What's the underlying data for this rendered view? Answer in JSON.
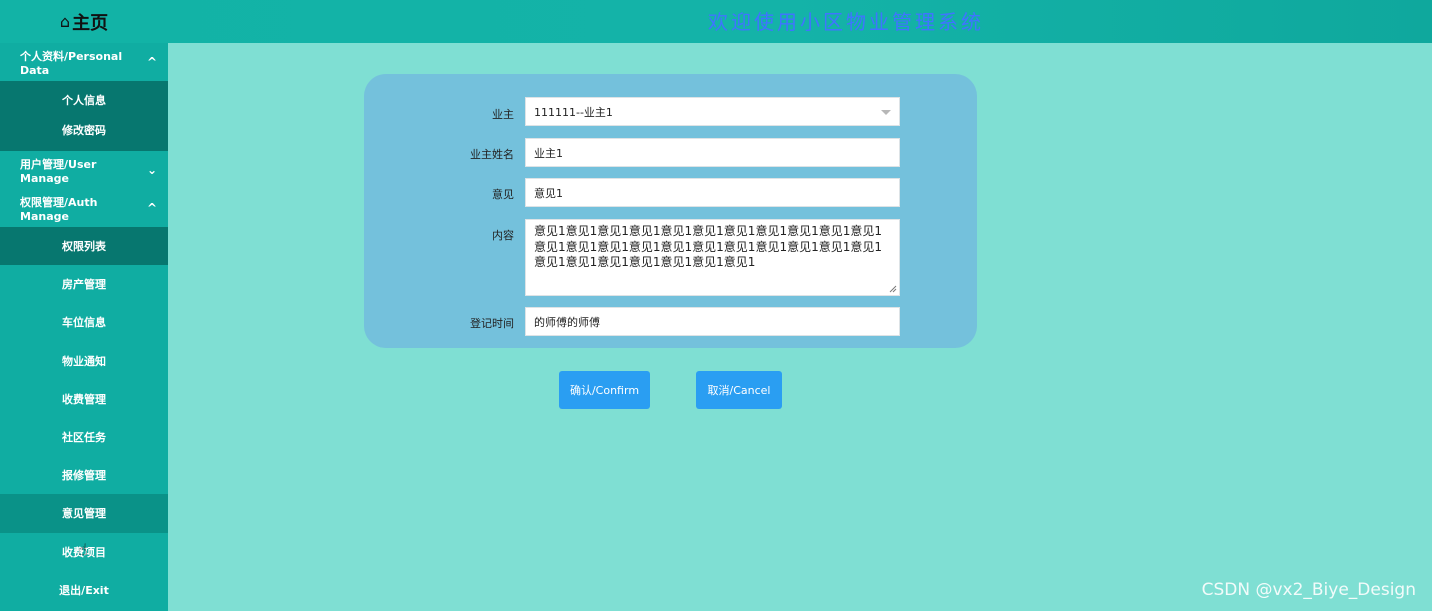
{
  "header": {
    "home_icon": "⌂",
    "home_label": "主页",
    "site_title": "欢迎使用小区物业管理系统"
  },
  "sidebar": {
    "personal": {
      "label": "个人资料/Personal Data",
      "chevron": "^",
      "items": [
        "个人信息",
        "修改密码"
      ]
    },
    "user": {
      "label": "用户管理/User Manage",
      "chevron": "⌄"
    },
    "auth": {
      "label": "权限管理/Auth Manage",
      "chevron": "^",
      "items": [
        "权限列表"
      ]
    },
    "nav": [
      "房产管理",
      "车位信息",
      "物业通知",
      "收费管理",
      "社区任务",
      "报修管理",
      "意见管理",
      "收费项目",
      "退出/Exit"
    ]
  },
  "form": {
    "owner_label": "业主",
    "owner_value": "111111--业主1",
    "owner_name_label": "业主姓名",
    "owner_name_value": "业主1",
    "opinion_label": "意见",
    "opinion_value": "意见1",
    "content_label": "内容",
    "content_value": "意见1意见1意见1意见1意见1意见1意见1意见1意见1意见1意见1意见1意见1意见1意见1意见1意见1意见1意见1意见1意见1意见1意见1意见1意见1意见1意见1意见1意见1",
    "register_time_label": "登记时间",
    "register_time_value": "的师傅的师傅"
  },
  "buttons": {
    "confirm": "确认/Confirm",
    "cancel": "取消/Cancel"
  },
  "watermark": "CSDN @vx2_Biye_Design",
  "colors": {
    "header": "#14b3a8",
    "sidebar": "#10ada2",
    "sidebar_dark": "#07776f",
    "page": "#7fdfd3",
    "card": "#74c1dc",
    "button": "#2a9ef2",
    "title": "#3f74ff"
  }
}
